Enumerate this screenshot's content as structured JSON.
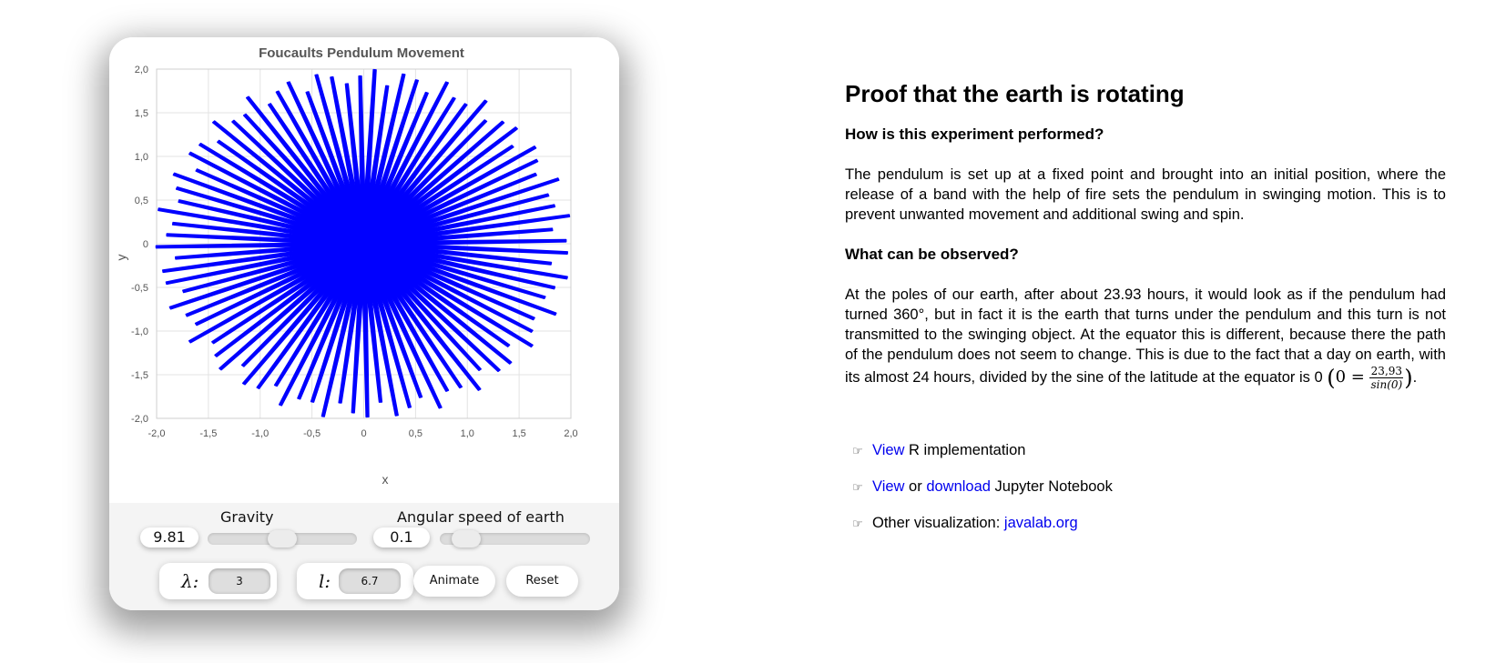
{
  "chart": {
    "title": "Foucaults Pendulum Movement",
    "xlabel": "x",
    "ylabel": "y",
    "x_ticks": [
      "-2,0",
      "-1,5",
      "-1,0",
      "-0,5",
      "0",
      "0,5",
      "1,0",
      "1,5",
      "2,0"
    ],
    "y_ticks": [
      "2,0",
      "1,5",
      "1,0",
      "0,5",
      "0",
      "-0,5",
      "-1,0",
      "-1,5",
      "-2,0"
    ],
    "color": "#0000ff"
  },
  "chart_data": {
    "type": "line",
    "title": "Foucaults Pendulum Movement",
    "xlabel": "x",
    "ylabel": "y",
    "xlim": [
      -2.0,
      2.0
    ],
    "ylim": [
      -2.0,
      2.0
    ],
    "grid": true,
    "legend": "none",
    "series": [
      {
        "color": "#0000ff",
        "spokes": 88,
        "amplitude": 2.0,
        "inner_radius": 0.6
      }
    ]
  },
  "controls": {
    "gravity_label": "Gravity",
    "gravity_value": "9.81",
    "gravity_fraction": 0.5,
    "angular_label": "Angular speed of earth",
    "angular_value": "0.1",
    "angular_fraction": 0.1,
    "lambda_symbol": "λ:",
    "lambda_value": "3",
    "l_symbol": "l:",
    "l_value": "6.7",
    "animate_label": "Animate",
    "reset_label": "Reset"
  },
  "article": {
    "title": "Proof that the earth is rotating",
    "q1": "How is this experiment performed?",
    "p1": "The pendulum is set up at a fixed point and brought into an initial position, where the release of a band with the help of fire sets the pendulum in swinging motion. This is to prevent unwanted movement and additional swing and spin.",
    "q2": "What can be observed?",
    "p2": "At the poles of our earth, after about 23.93 hours, it would look as if the pendulum had turned 360°, but in fact it is the earth that turns under the pendulum and this turn is not transmitted to the swinging object. At the equator this is different, because there the path of the pendulum does not seem to change. This is due to the fact that a day on earth, with its almost 24 hours, divided by the sine of the latitude at the equator is 0",
    "formula_lhs": "0 =",
    "formula_num": "23,93",
    "formula_den": "sin(0)",
    "formula_end": "."
  },
  "links": {
    "icon": "pointing-hand-icon",
    "row1_link": "View",
    "row1_text": " R implementation",
    "row2_link1": "View",
    "row2_mid": " or ",
    "row2_link2": "download",
    "row2_text": " Jupyter Notebook",
    "row3_text": "Other visualization: ",
    "row3_link": "javalab.org"
  }
}
